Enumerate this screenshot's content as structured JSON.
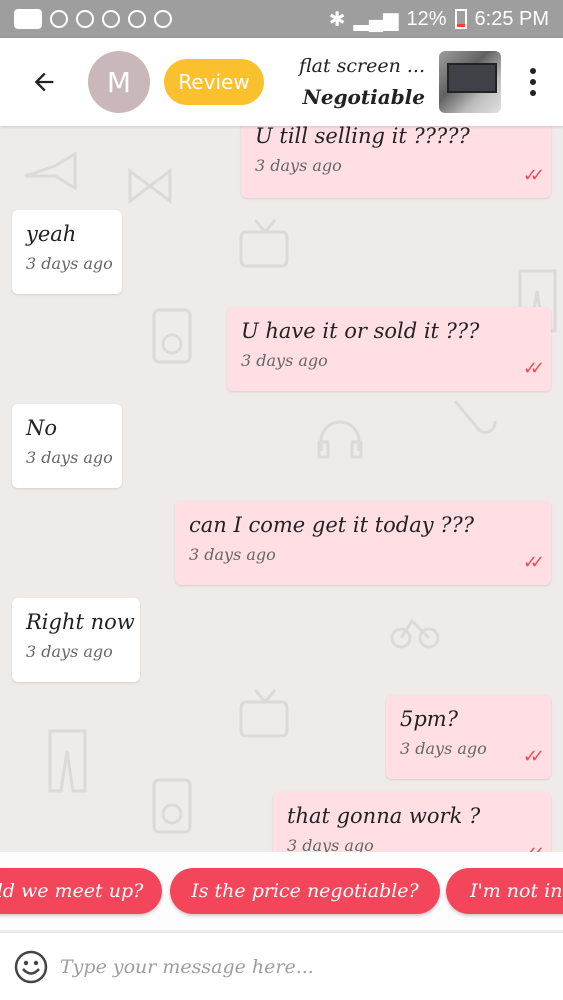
{
  "status_bar": {
    "battery": "12%",
    "time": "6:25 PM"
  },
  "header": {
    "avatar_letter": "M",
    "review_label": "Review",
    "item_title": "flat screen ...",
    "item_price": "Negotiable"
  },
  "messages": [
    {
      "text": "U till selling it ?????",
      "time": "3 days ago",
      "direction": "out"
    },
    {
      "text": "yeah",
      "time": "3 days ago",
      "direction": "in"
    },
    {
      "text": "U have it or sold it ???",
      "time": "3 days ago",
      "direction": "out"
    },
    {
      "text": "No",
      "time": "3 days ago",
      "direction": "in"
    },
    {
      "text": "can I come get it today ???",
      "time": "3 days ago",
      "direction": "out"
    },
    {
      "text": "Right now",
      "time": "3 days ago",
      "direction": "in"
    },
    {
      "text": "5pm?",
      "time": "3 days ago",
      "direction": "out"
    },
    {
      "text": "that gonna work ?",
      "time": "3 days ago",
      "direction": "out"
    }
  ],
  "quick_replies": [
    "ld we meet up?",
    "Is the price negotiable?",
    "I'm not int"
  ],
  "input": {
    "placeholder": "Type your message here..."
  },
  "colors": {
    "accent": "#f3465a",
    "review": "#fbc02d",
    "outgoing_bubble": "#ffdfe4",
    "incoming_bubble": "#ffffff",
    "read_tick": "#ef4b57"
  }
}
